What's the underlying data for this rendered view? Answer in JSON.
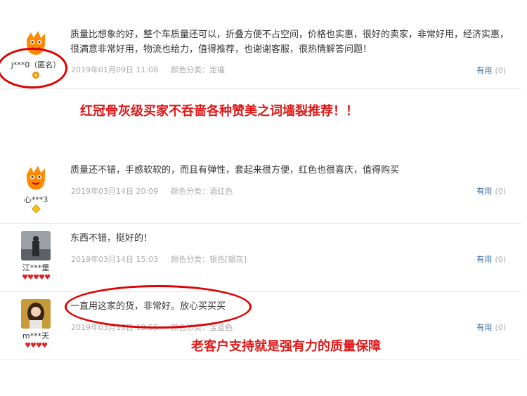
{
  "reviews": [
    {
      "user": "j***0（匿名）",
      "avatar": "orange-mascot",
      "rank": "orange-medal",
      "text": "质量比想象的好，整个车质量还可以，折叠方便不占空间，价格也实惠，很好的卖家，非常好用，经济实惠，很满意非常好用，物流也给力，值得推荐，也谢谢客服，很热情解答问题！",
      "date": "2019年01月09日 11:08",
      "sku": "颜色分类：定催",
      "useful_label": "有用",
      "useful_count": "(0)"
    },
    {
      "user": "心***3",
      "avatar": "orange-mascot",
      "rank": "gold-diamond",
      "text": "质量还不错，手感软软的，而且有弹性，套起来很方便，红色也很喜庆，值得购买",
      "date": "2019年03月14日 20:09",
      "sku": "颜色分类：酒红色",
      "useful_label": "有用",
      "useful_count": "(0)"
    },
    {
      "user": "江***堡",
      "avatar": "gray-photo",
      "rank": "red-hearts-5",
      "text": "东西不错，挺好的！",
      "date": "2019年03月14日 15:03",
      "sku": "颜色分类：银色[银灰]",
      "useful_label": "有用",
      "useful_count": "(0)"
    },
    {
      "user": "m***天",
      "avatar": "woman-photo",
      "rank": "red-hearts-4",
      "text": "一直用这家的货，非常好。放心买买买",
      "date": "2019年03月13日 10:55",
      "sku": "颜色分类：宝蓝色",
      "useful_label": "有用",
      "useful_count": "(0)"
    }
  ],
  "annotations": {
    "top": "红冠骨灰级买家不呑啬各种赞美之词墙裂推荐！！",
    "bottom": "老客户支持就是强有力的质量保障"
  },
  "colors": {
    "annotation": "#e01818",
    "useful_link": "#336699",
    "meta": "#aaaaaa"
  }
}
